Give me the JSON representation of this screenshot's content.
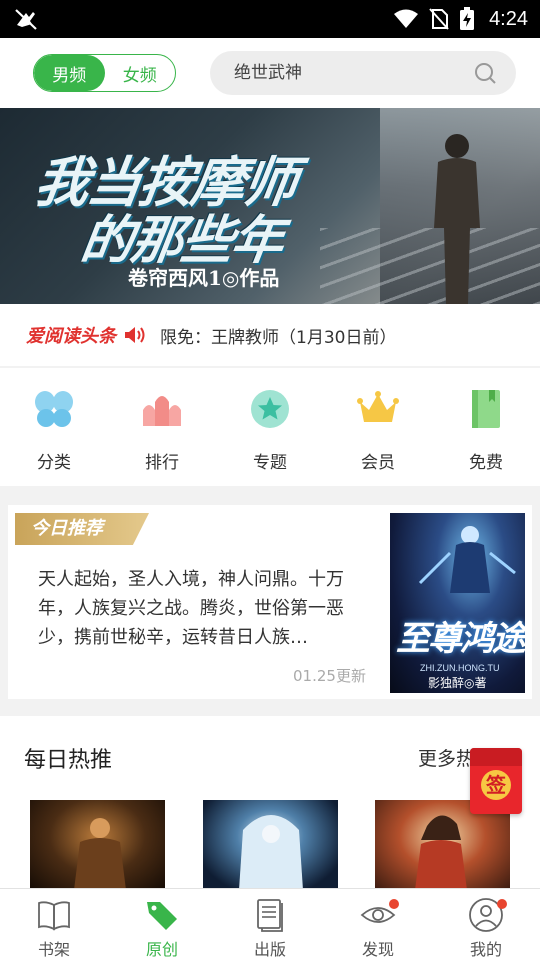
{
  "status_bar": {
    "time": "4:24",
    "icons": [
      "notification-off-icon",
      "wifi-icon",
      "no-sim-icon",
      "battery-charging-icon"
    ]
  },
  "top_bar": {
    "toggle": {
      "male_label": "男频",
      "female_label": "女频",
      "selected": "男频"
    },
    "search": {
      "value": "绝世武神"
    }
  },
  "banner": {
    "title_line1": "我当按摩师",
    "title_line2": "的那些年",
    "author_line": "卷帘西风1◎作品"
  },
  "ticker": {
    "brand": "爱阅读头条",
    "text": "限免：王牌教师（1月30日前）"
  },
  "categories": [
    {
      "label": "分类",
      "icon": "butterfly-icon"
    },
    {
      "label": "排行",
      "icon": "ranking-icon"
    },
    {
      "label": "专题",
      "icon": "star-badge-icon"
    },
    {
      "label": "会员",
      "icon": "crown-icon"
    },
    {
      "label": "免费",
      "icon": "book-free-icon"
    }
  ],
  "today": {
    "tag": "今日推荐",
    "description": "天人起始，圣人入境，神人问鼎。十万年，人族复兴之战。腾炎，世俗第一恶少，携前世秘辛，运转昔日人族…",
    "updated": "01.25更新",
    "cover": {
      "title": "至尊鸿途",
      "pinyin": "ZHI.ZUN.HONG.TU",
      "author": "影独醉◎著"
    }
  },
  "hot": {
    "title": "每日热推",
    "more": "更多热推"
  },
  "sign_badge": {
    "label": "签"
  },
  "bottom_nav": [
    {
      "label": "书架",
      "icon": "bookshelf-icon",
      "active": false,
      "dot": false
    },
    {
      "label": "原创",
      "icon": "tag-icon",
      "active": true,
      "dot": false
    },
    {
      "label": "出版",
      "icon": "publish-book-icon",
      "active": false,
      "dot": false
    },
    {
      "label": "发现",
      "icon": "eye-icon",
      "active": false,
      "dot": true
    },
    {
      "label": "我的",
      "icon": "user-icon",
      "active": false,
      "dot": true
    }
  ],
  "colors": {
    "accent_green": "#39b54a",
    "brand_red": "#e0322f",
    "gold": "#c9a45a"
  }
}
